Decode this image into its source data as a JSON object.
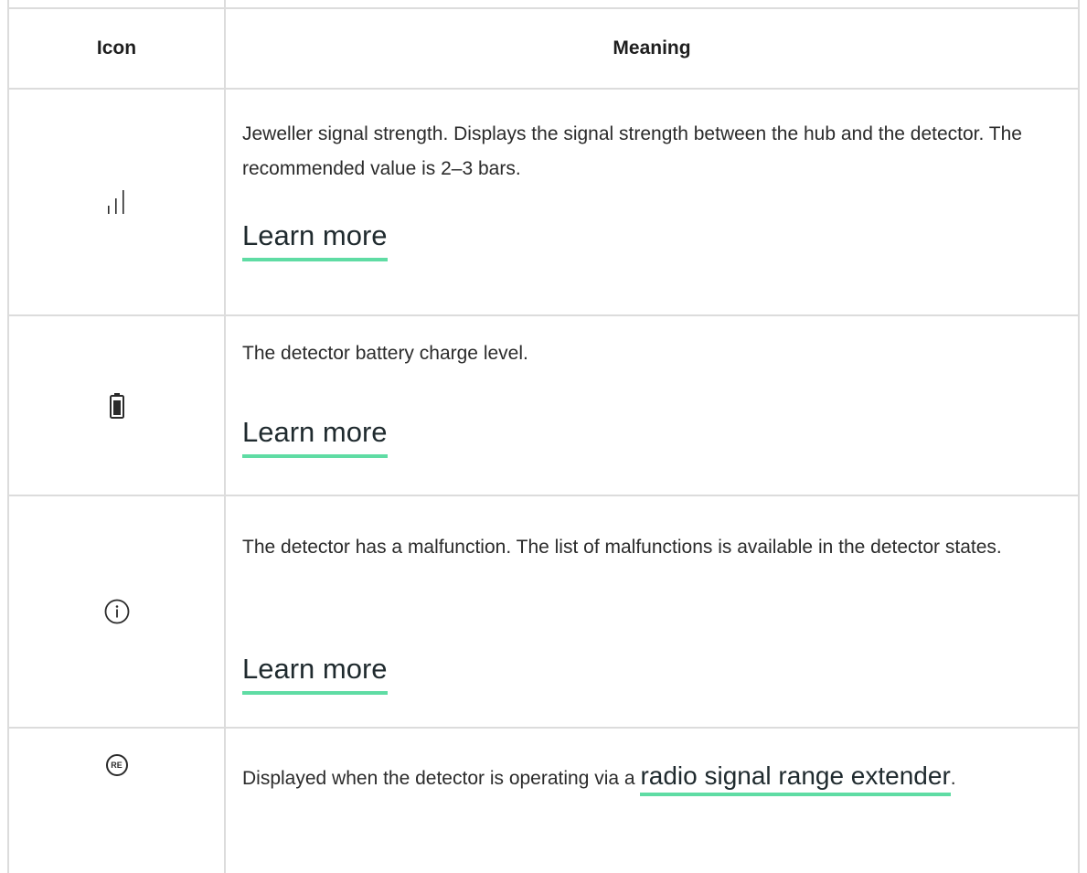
{
  "table": {
    "headers": {
      "icon": "Icon",
      "meaning": "Meaning"
    },
    "rows": [
      {
        "icon": "signal-strength-icon",
        "text": "Jeweller signal strength. Displays the signal strength between the hub and the detector. The recommended value is 2–3 bars.",
        "link": "Learn more"
      },
      {
        "icon": "battery-icon",
        "text": "The detector battery charge level.",
        "link": "Learn more"
      },
      {
        "icon": "info-icon",
        "text": "The detector has a malfunction. The list of malfunctions is available in the detector states.",
        "link": "Learn more"
      },
      {
        "icon": "range-extender-icon",
        "icon_text": "RE",
        "text_before": "Displayed when the detector is operating via a",
        "link": "radio signal range extender",
        "text_after": "."
      }
    ]
  },
  "colors": {
    "link_underline": "#5fdca4",
    "border": "#dcdcdc",
    "text": "#2b2b2b"
  }
}
